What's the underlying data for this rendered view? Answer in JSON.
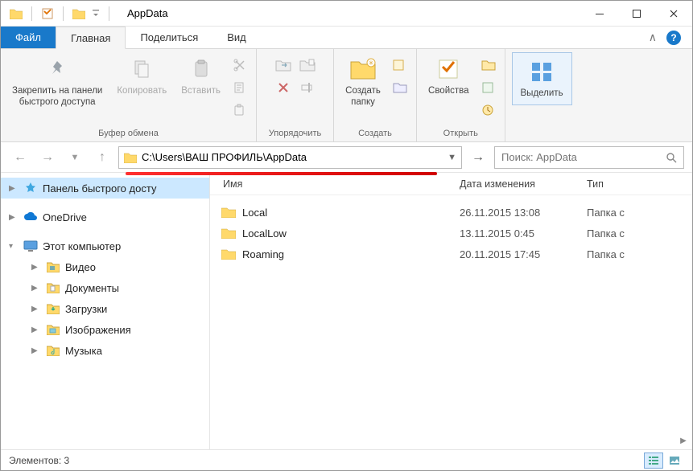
{
  "title": "AppData",
  "tabs": {
    "file": "Файл",
    "home": "Главная",
    "share": "Поделиться",
    "view": "Вид"
  },
  "ribbon": {
    "clipboard": {
      "pin": "Закрепить на панели\nбыстрого доступа",
      "copy": "Копировать",
      "paste": "Вставить",
      "label": "Буфер обмена"
    },
    "organize": {
      "label": "Упорядочить"
    },
    "new": {
      "newfolder": "Создать\nпапку",
      "label": "Создать"
    },
    "open": {
      "properties": "Свойства",
      "label": "Открыть"
    },
    "select": {
      "select": "Выделить",
      "label": ""
    }
  },
  "address": {
    "path": "C:\\Users\\ВАШ ПРОФИЛЬ\\AppData"
  },
  "search": {
    "placeholder": "Поиск: AppData"
  },
  "nav": {
    "quick": "Панель быстрого досту",
    "onedrive": "OneDrive",
    "thispc": "Этот компьютер",
    "children": [
      {
        "label": "Видео"
      },
      {
        "label": "Документы"
      },
      {
        "label": "Загрузки"
      },
      {
        "label": "Изображения"
      },
      {
        "label": "Музыка"
      }
    ]
  },
  "columns": {
    "name": "Имя",
    "date": "Дата изменения",
    "type": "Тип"
  },
  "files": [
    {
      "name": "Local",
      "date": "26.11.2015 13:08",
      "type": "Папка с"
    },
    {
      "name": "LocalLow",
      "date": "13.11.2015 0:45",
      "type": "Папка с"
    },
    {
      "name": "Roaming",
      "date": "20.11.2015 17:45",
      "type": "Папка с"
    }
  ],
  "status": {
    "count": "Элементов: 3"
  }
}
